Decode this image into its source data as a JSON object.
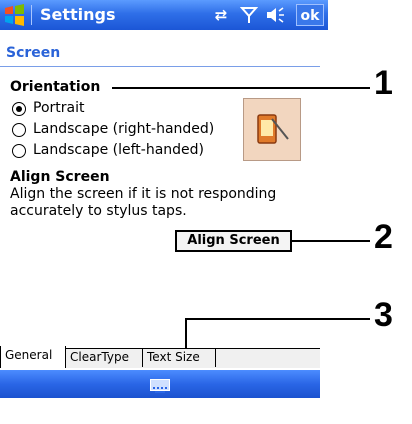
{
  "titlebar": {
    "title": "Settings",
    "ok_label": "ok",
    "icons": [
      "windows-logo-icon",
      "sync-icon",
      "signal-icon",
      "speaker-icon"
    ]
  },
  "section_title": "Screen",
  "orientation": {
    "heading": "Orientation",
    "options": [
      {
        "label": "Portrait",
        "selected": true
      },
      {
        "label": "Landscape (right-handed)",
        "selected": false
      },
      {
        "label": "Landscape (left-handed)",
        "selected": false
      }
    ]
  },
  "align": {
    "heading": "Align Screen",
    "description_line1": "Align the screen if it is not responding",
    "description_line2": "accurately to stylus taps.",
    "button_label": "Align Screen"
  },
  "tabs": [
    "General",
    "ClearType",
    "Text Size"
  ],
  "callouts": [
    "1",
    "2",
    "3"
  ],
  "colors": {
    "titlebar": "#2f6fe8",
    "section_title": "#2a63d8",
    "bottombar": "#2a66e6"
  }
}
